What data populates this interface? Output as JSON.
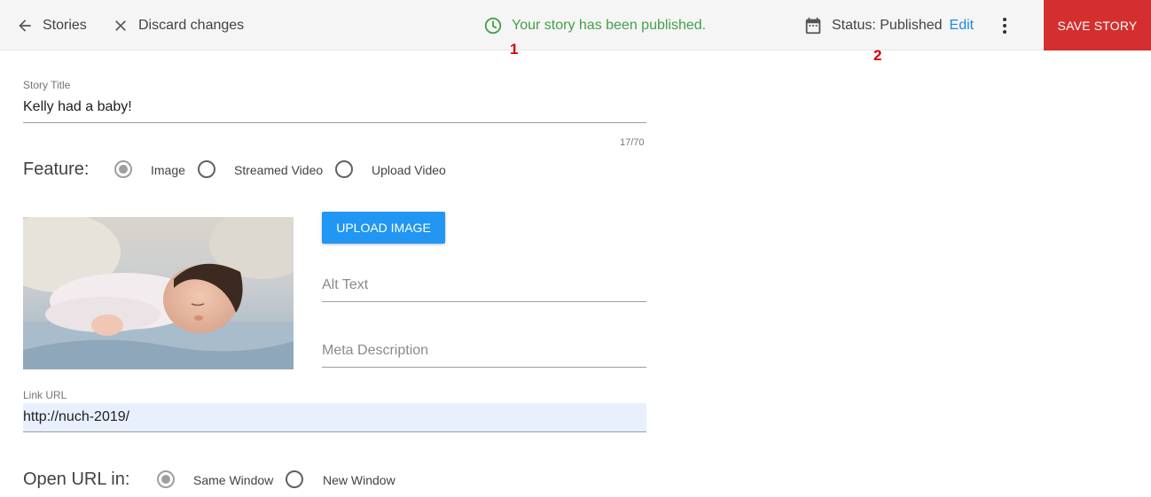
{
  "topbar": {
    "back_label": "Stories",
    "discard_label": "Discard changes",
    "published_message": "Your story has been published.",
    "status_text": "Status: Published",
    "edit_label": "Edit",
    "save_label": "SAVE STORY"
  },
  "annotations": [
    "1",
    "2"
  ],
  "form": {
    "title": {
      "label": "Story Title",
      "value": "Kelly had a baby!",
      "counter": "17/70"
    },
    "feature": {
      "label": "Feature:",
      "options": [
        {
          "label": "Image",
          "checked": true
        },
        {
          "label": "Streamed Video",
          "checked": false
        },
        {
          "label": "Upload Video",
          "checked": false
        }
      ]
    },
    "upload_label": "UPLOAD IMAGE",
    "alt_text_placeholder": "Alt Text",
    "meta_description_placeholder": "Meta Description",
    "link_url": {
      "label": "Link URL",
      "value": "http://nuch-2019/"
    },
    "open_url": {
      "label": "Open URL in:",
      "options": [
        {
          "label": "Same Window",
          "checked": true
        },
        {
          "label": "New Window",
          "checked": false
        }
      ]
    }
  },
  "colors": {
    "accent_red": "#d32f2f",
    "accent_blue": "#2196f3",
    "success_green": "#43a047",
    "link_blue": "#1e88e5"
  }
}
